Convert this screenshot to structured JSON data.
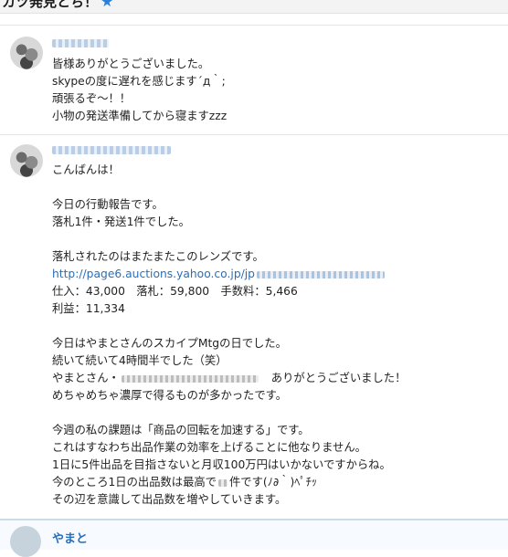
{
  "header": {
    "title": "カツ発見とち！"
  },
  "comments": [
    {
      "lines": [
        "皆様ありがとうございました。",
        "skypeの度に遅れを感じます´д｀;",
        "頑張るぞ～！！",
        "小物の発送準備してから寝ますzzz"
      ]
    },
    {
      "lines": {
        "greeting": "こんばんは！",
        "report_1": "今日の行動報告です。",
        "report_2": "落札1件・発送1件でした。",
        "lens_1": "落札されたのはまたまたこのレンズです。",
        "link": "http://page6.auctions.yahoo.co.jp/jp",
        "numbers_1": "仕入：43,000　落札：59,800　手数料：5,466",
        "numbers_2": "利益：11,334",
        "mtg_1": "今日はやまとさんのスカイプMtgの日でした。",
        "mtg_2": "続いて続いて4時間半でした（笑）",
        "mtg_3a": "やまとさん・",
        "mtg_3b": "ありがとうございました！",
        "mtg_4": "めちゃめちゃ濃厚で得るものが多かったです。",
        "theme_1": "今週の私の課題は「商品の回転を加速する」です。",
        "theme_2": "これはすなわち出品作業の効率を上げることに他なりません。",
        "theme_3": "1日に5件出品を目指さないと月収100万円はいかないですからね。",
        "theme_4": "今のところ1日の出品数は最高で",
        "theme_4b": "件です(ﾉ∂｀)ﾍﾟﾁｯ",
        "theme_5": "その辺を意識して出品数を増やしていきます。"
      }
    },
    {
      "username": "やまと"
    }
  ],
  "colors": {
    "link": "#2a6ebb",
    "accent_star": "#2c7fd8",
    "divider": "#e6e6e6"
  },
  "icons": [
    "star-icon",
    "avatar-image"
  ]
}
